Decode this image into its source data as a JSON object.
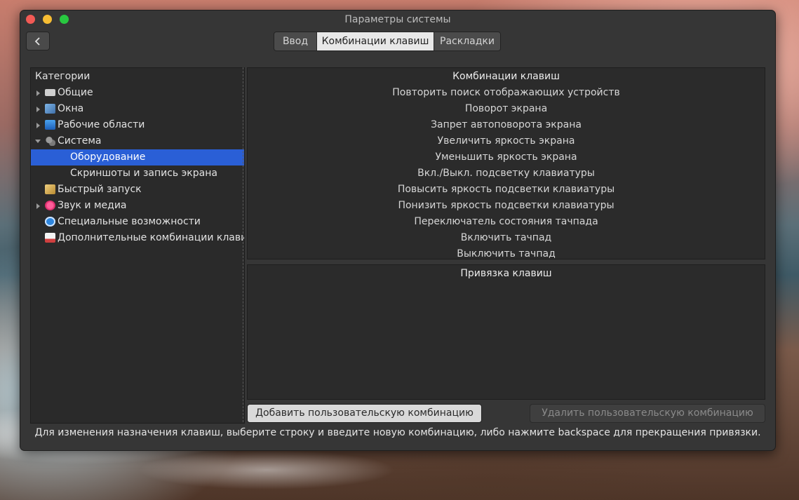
{
  "window": {
    "title": "Параметры системы"
  },
  "toolbar": {
    "back_icon": "chevron-left-icon",
    "tabs": [
      {
        "label": "Ввод",
        "active": false
      },
      {
        "label": "Комбинации клавиш",
        "active": true
      },
      {
        "label": "Раскладки",
        "active": false
      }
    ]
  },
  "sidebar": {
    "header": "Категории",
    "items": [
      {
        "label": "Общие",
        "icon": "keyboard-icon",
        "expandable": true,
        "expanded": false
      },
      {
        "label": "Окна",
        "icon": "windows-icon",
        "expandable": true,
        "expanded": false
      },
      {
        "label": "Рабочие области",
        "icon": "monitor-icon",
        "expandable": true,
        "expanded": false
      },
      {
        "label": "Система",
        "icon": "gears-icon",
        "expandable": true,
        "expanded": true
      },
      {
        "label": "Оборудование",
        "sub": true,
        "selected": true
      },
      {
        "label": "Скриншоты и запись экрана",
        "sub": true,
        "selected": false
      },
      {
        "label": "Быстрый запуск",
        "icon": "launcher-icon",
        "expandable": false
      },
      {
        "label": "Звук и медиа",
        "icon": "music-icon",
        "expandable": true,
        "expanded": false
      },
      {
        "label": "Специальные возможности",
        "icon": "accessibility-icon",
        "expandable": false
      },
      {
        "label": "Дополнительные комбинации клавиш",
        "icon": "custom-shortcuts-icon",
        "expandable": false
      }
    ]
  },
  "shortcuts": {
    "header": "Комбинации клавиш",
    "items": [
      "Повторить поиск отображающих устройств",
      "Поворот экрана",
      "Запрет автоповорота экрана",
      "Увеличить яркость экрана",
      "Уменьшить яркость экрана",
      "Вкл./Выкл. подсветку клавиатуры",
      "Повысить яркость подсветки клавиатуры",
      "Понизить яркость подсветки клавиатуры",
      "Переключатель состояния тачпада",
      "Включить тачпад",
      "Выключить тачпад"
    ]
  },
  "bindings": {
    "header": "Привязка клавиш"
  },
  "buttons": {
    "add": "Добавить пользовательскую комбинацию",
    "remove": "Удалить пользовательскую комбинацию"
  },
  "hint": "Для изменения назначения клавиш, выберите строку и введите новую комбинацию, либо нажмите backspace для прекращения привязки.",
  "colors": {
    "selection": "#2a5fd6",
    "close": "#f25a55",
    "minimize": "#f7bd33",
    "maximize": "#28c840"
  }
}
